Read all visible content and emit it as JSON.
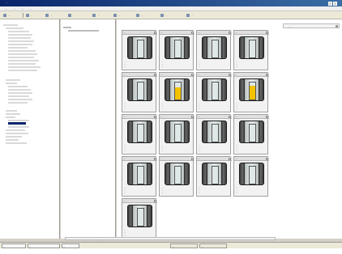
{
  "window": {
    "title": "…",
    "colors": {
      "titlebar": "#0a246a",
      "accent_fill": "#f2c200"
    }
  },
  "menu": {
    "items": [
      "…",
      "…",
      "…",
      "…"
    ]
  },
  "toolbar": {
    "buttons": [
      "…",
      "…",
      "…",
      "…",
      "…",
      "…",
      "…",
      "…",
      "…"
    ]
  },
  "right_panel": {
    "header": "…"
  },
  "library": {
    "cards": [
      {
        "id": "…",
        "fill_percent": 0,
        "lines": [
          "…",
          "…",
          "…"
        ]
      },
      {
        "id": "…",
        "fill_percent": 0,
        "lines": [
          "…",
          "…",
          "…"
        ]
      },
      {
        "id": "…",
        "fill_percent": 0,
        "lines": [
          "…",
          "…",
          "…"
        ]
      },
      {
        "id": "…",
        "fill_percent": 0,
        "lines": [
          "…",
          "…",
          "…"
        ]
      },
      {
        "id": "…",
        "fill_percent": 0,
        "lines": [
          "…",
          "…",
          "…"
        ]
      },
      {
        "id": "…",
        "fill_percent": 70,
        "lines": [
          "…",
          "…",
          "…"
        ]
      },
      {
        "id": "…",
        "fill_percent": 0,
        "lines": [
          "…",
          "…",
          "…"
        ]
      },
      {
        "id": "…",
        "fill_percent": 80,
        "lines": [
          "…",
          "…",
          "…"
        ]
      },
      {
        "id": "…",
        "fill_percent": 0,
        "lines": [
          "…",
          "…",
          "…"
        ]
      },
      {
        "id": "…",
        "fill_percent": 0,
        "lines": [
          "…",
          "…",
          "…"
        ]
      },
      {
        "id": "…",
        "fill_percent": 0,
        "lines": [
          "…",
          "…",
          "…"
        ]
      },
      {
        "id": "…",
        "fill_percent": 0,
        "lines": [
          "…",
          "…",
          "…"
        ]
      },
      {
        "id": "…",
        "fill_percent": 0,
        "lines": [
          "…",
          "…",
          "…"
        ]
      },
      {
        "id": "…",
        "fill_percent": 0,
        "lines": [
          "…",
          "…",
          "…"
        ]
      },
      {
        "id": "…",
        "fill_percent": 0,
        "lines": [
          "…",
          "…",
          "…"
        ]
      },
      {
        "id": "…",
        "fill_percent": 0,
        "lines": [
          "…",
          "…",
          "…"
        ]
      },
      {
        "id": "…",
        "fill_percent": 0,
        "lines": [
          "…",
          "…",
          "…"
        ]
      }
    ]
  },
  "bottom_pane": {
    "text": "…"
  },
  "statusbar": {
    "tabs": [
      "…",
      "…",
      "…"
    ],
    "fields": [
      "…",
      "…"
    ]
  }
}
